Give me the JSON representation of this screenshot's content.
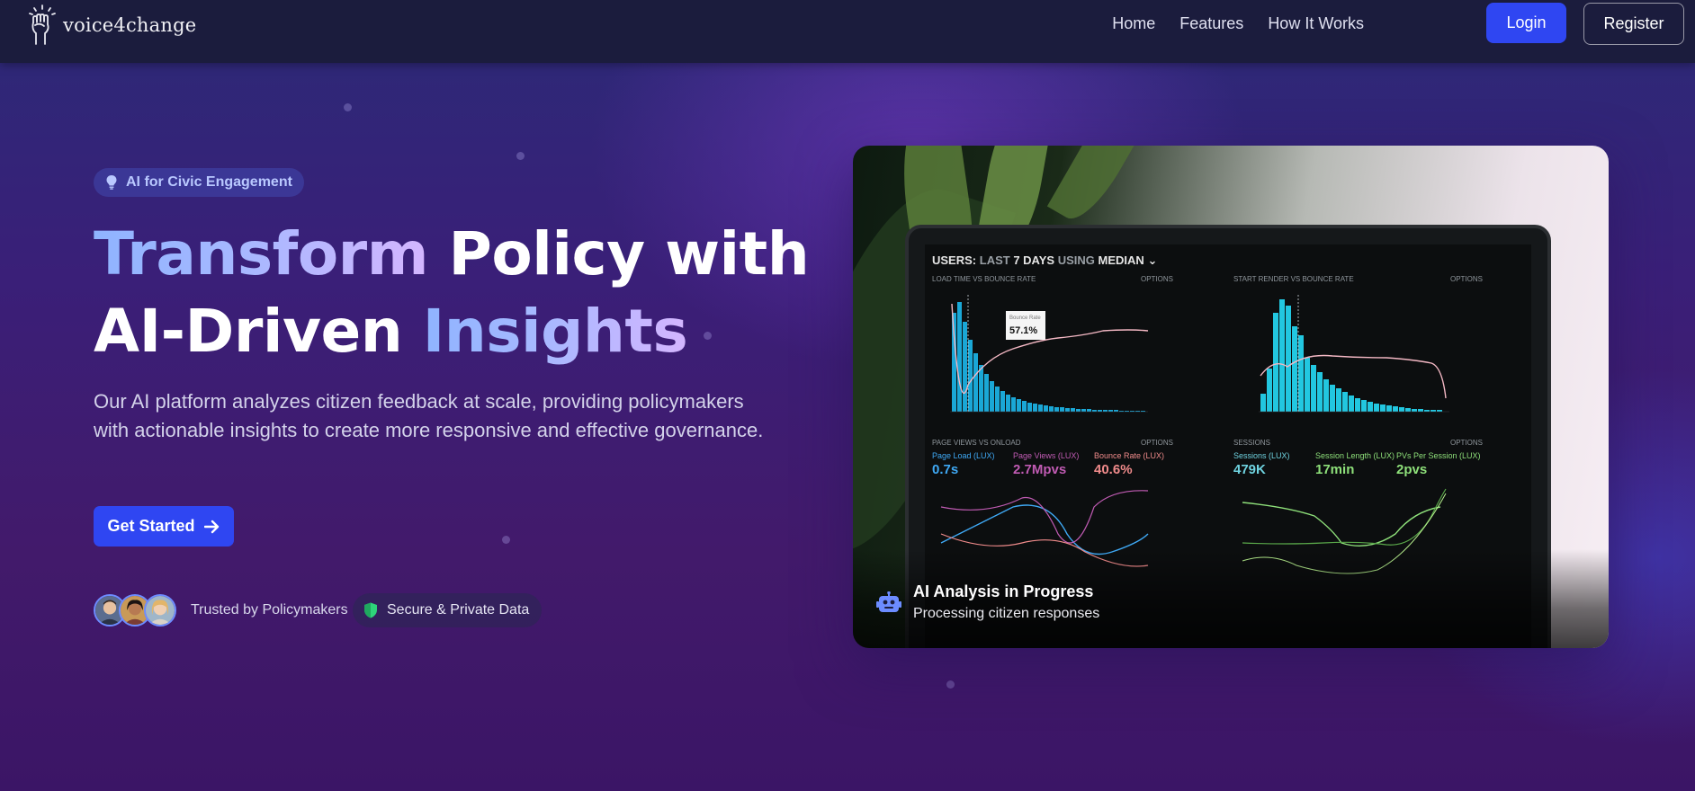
{
  "brand": {
    "name": "voice4change"
  },
  "nav": {
    "links": [
      "Home",
      "Features",
      "How It Works"
    ],
    "login_label": "Login",
    "register_label": "Register"
  },
  "hero": {
    "badge": "AI for Civic Engagement",
    "headline": {
      "line1_gradient": "Transform",
      "line1_rest": " Policy with",
      "line2_start": "AI-Driven ",
      "line2_gradient": "Insights"
    },
    "description": "Our AI platform analyzes citizen feedback at scale, providing policymakers with actionable insights to create more responsive and effective governance.",
    "cta_label": "Get Started",
    "trust_text": "Trusted by Policymakers",
    "secure_text": "Secure & Private Data"
  },
  "card": {
    "title": "AI Analysis in Progress",
    "subtitle": "Processing citizen responses",
    "screen": {
      "header_users": "USERS:",
      "header_last": "LAST",
      "header_7days": "7 DAYS",
      "header_using": "USING",
      "header_median": "MEDIAN",
      "panel1_title": "LOAD TIME VS BOUNCE RATE",
      "panel2_title": "START RENDER VS BOUNCE RATE",
      "panel3_title": "PAGE VIEWS VS ONLOAD",
      "panel4_title": "SESSIONS",
      "options": "OPTIONS",
      "tooltip_label": "Bounce Rate",
      "tooltip_value": "57.1%",
      "stats": [
        {
          "label": "Page Load (LUX)",
          "value": "0.7s",
          "color": "#3fa9f5"
        },
        {
          "label": "Page Views (LUX)",
          "value": "2.7Mpvs",
          "color": "#c05bb3"
        },
        {
          "label": "Bounce Rate (LUX)",
          "value": "40.6%",
          "color": "#f08b8b"
        },
        {
          "label": "Sessions (LUX)",
          "value": "479K",
          "color": "#6fd3e0"
        },
        {
          "label": "Session Length (LUX)",
          "value": "17min",
          "color": "#8ee07a"
        },
        {
          "label": "PVs Per Session (LUX)",
          "value": "2pvs",
          "color": "#8ee07a"
        }
      ]
    }
  },
  "colors": {
    "primary": "#2f46f2",
    "nav_bg": "#1b1c3d",
    "gradient_start": "#8fb4ff",
    "gradient_end": "#d4b6ff"
  }
}
